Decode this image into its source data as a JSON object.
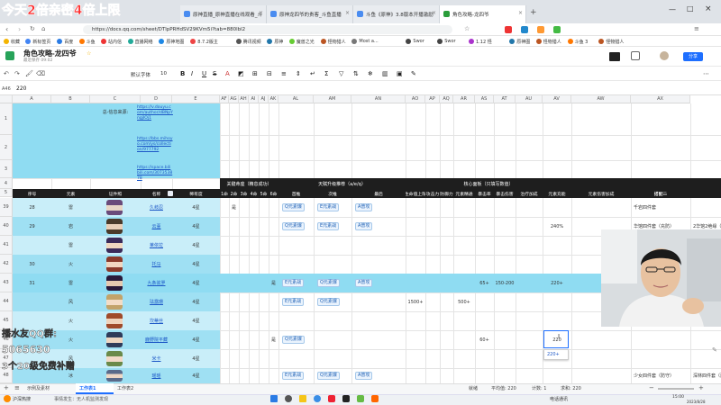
{
  "browser": {
    "tabs": [
      {
        "label": "原神直播_原神直播在线观看_斗",
        "active": false
      },
      {
        "label": "原神龙四爷的贵客_斗鱼直播",
        "active": false
      },
      {
        "label": "斗鱼《原神》3.8版本开播激励",
        "active": false
      },
      {
        "label": "角色攻略-龙四爷",
        "active": true
      }
    ],
    "url": "https://docs.qq.com/sheet/DTlpPRHdSV29KVm5i?tab=880lbl2",
    "bookmarks": [
      "收藏",
      "新标签页",
      "百度",
      "斗鱼",
      "站内信",
      "直播网络",
      "原神地图",
      "8.7.2版主",
      "腾讯视频",
      "原神",
      "魔兽之光",
      "怪物猎人",
      "Most a...",
      "Swor",
      "Swor",
      "1.12 怪",
      "原神图",
      "怪物猎人",
      "斗鱼 3",
      "怪物猎人"
    ]
  },
  "doc": {
    "title": "角色攻略-龙四爷",
    "subtitle": "最近保存 09:02",
    "share_label": "分享",
    "font_name": "默认字体",
    "font_size": "10",
    "cell_ref": "A46",
    "formula_value": "220"
  },
  "overlay": {
    "banner": "今天2倍亲密4倍上限",
    "fan_group_label": "播水友QQ群:",
    "fan_group_number": "5065630",
    "fan_group_extra": "3个20级免费补赠"
  },
  "columns": [
    "A",
    "B",
    "C",
    "D",
    "E",
    "AF",
    "AG",
    "AH",
    "AI",
    "AJ",
    "AK",
    "AL",
    "AM",
    "AN",
    "AO",
    "AP",
    "AQ",
    "AR",
    "AS",
    "AT",
    "AU",
    "AV",
    "AW",
    "AX"
  ],
  "rows": [
    "1",
    "2",
    "3",
    "4",
    "5",
    "39",
    "40",
    "41",
    "42",
    "43",
    "44",
    "45",
    "46",
    "47",
    "48"
  ],
  "info": {
    "label": "总-信息来源:",
    "link1": "https://v.douyu.com/author/dBNpYngjIOj1",
    "link2": "https://bbs.mihoyo.com/ys/collection/977792",
    "link3": "https://space.bilibili.com/307353878"
  },
  "section_headers": {
    "constellation": "关键命座（精息成功）",
    "talent": "天赋升级推荐（a/e/q）",
    "core_panel": "核心面板（只填写数值）"
  },
  "headers": {
    "serial": "序号",
    "element": "元素",
    "portrait": "证件照",
    "name": "名称",
    "rarity": "稀有度",
    "c1": "1命",
    "c2": "2命",
    "c3": "3命",
    "c4": "4命",
    "c5": "5命",
    "c6": "6命",
    "t_first": "首推",
    "t_second": "次推",
    "t_last": "最后",
    "hp": "生命值上限",
    "atk": "攻击力",
    "def": "防御力",
    "em": "元素精通",
    "crit_rate": "暴击率",
    "crit_dmg": "暴击伤害",
    "heal": "治疗加成",
    "er": "元素充能",
    "elem_dmg": "元素伤害加成",
    "set1": "搭配一",
    "set2": "搭配二"
  },
  "table_rows": [
    {
      "row": "39",
      "serial": "28",
      "element": "雷",
      "name": "久岐忍",
      "rarity": "4星",
      "c1": "",
      "c2": "是",
      "c6": "",
      "t_first": "Q元素爆",
      "t_second": "E元素战",
      "t_last": "A普攻",
      "hp": "",
      "atk": "",
      "def": "",
      "em": "",
      "cr": "",
      "cd": "",
      "heal": "",
      "er": "",
      "set1": "千岩四件套",
      "set2": "",
      "highlight": false
    },
    {
      "row": "40",
      "serial": "29",
      "element": "岩",
      "name": "云堇",
      "rarity": "4星",
      "c1": "",
      "c2": "",
      "c6": "",
      "t_first": "Q元素爆",
      "t_second": "E元素战",
      "t_last": "A普攻",
      "hp": "",
      "atk": "",
      "def": "",
      "em": "",
      "cr": "",
      "cd": "",
      "heal": "",
      "er": "240%",
      "set1": "华馆四件套（充防）",
      "set2": "2华馆2绝缘（防）",
      "highlight": false
    },
    {
      "row": "41",
      "serial": "",
      "element": "雷",
      "name": "莱依拉",
      "rarity": "4星",
      "c1": "",
      "c2": "",
      "c6": "",
      "t_first": "",
      "t_second": "",
      "t_last": "",
      "hp": "",
      "atk": "",
      "def": "",
      "em": "",
      "cr": "",
      "cd": "",
      "heal": "",
      "er": "",
      "set1": "",
      "set2": "",
      "highlight": false
    },
    {
      "row": "42",
      "serial": "30",
      "element": "火",
      "name": "托马",
      "rarity": "4星",
      "c1": "",
      "c2": "",
      "c6": "",
      "t_first": "",
      "t_second": "",
      "t_last": "",
      "hp": "",
      "atk": "",
      "def": "",
      "em": "",
      "cr": "",
      "cd": "",
      "heal": "",
      "er": "",
      "set1": "",
      "set2": "",
      "highlight": false
    },
    {
      "row": "43",
      "serial": "31",
      "element": "雷",
      "name": "九条裟罗",
      "rarity": "4星",
      "c1": "",
      "c2": "",
      "c6": "是",
      "t_first": "E元素战",
      "t_second": "Q元素爆",
      "t_last": "A普攻",
      "hp": "",
      "atk": "",
      "def": "",
      "em": "",
      "cr": "65+",
      "cd": "150-200",
      "heal": "",
      "er": "220+",
      "set1": "",
      "set2": "",
      "highlight": true
    },
    {
      "row": "44",
      "serial": "",
      "element": "风",
      "name": "珐露珊",
      "rarity": "4星",
      "c1": "",
      "c2": "",
      "c6": "",
      "t_first": "E元素战",
      "t_second": "Q元素爆",
      "t_last": "",
      "hp": "1500+",
      "atk": "",
      "def": "",
      "em": "500+",
      "cr": "",
      "cd": "",
      "heal": "",
      "er": "",
      "set1": "",
      "set2": "",
      "highlight": false
    },
    {
      "row": "45",
      "serial": "",
      "element": "火",
      "name": "坎蒂丝",
      "rarity": "4星",
      "c1": "",
      "c2": "",
      "c6": "",
      "t_first": "",
      "t_second": "",
      "t_last": "",
      "hp": "",
      "atk": "",
      "def": "",
      "em": "",
      "cr": "",
      "cd": "",
      "heal": "",
      "er": "",
      "set1": "",
      "set2": "",
      "highlight": false
    },
    {
      "row": "46",
      "serial": "",
      "element": "火",
      "name": "鹿野院平藏",
      "rarity": "4星",
      "c1": "",
      "c2": "",
      "c6": "是",
      "t_first": "Q元素爆",
      "t_second": "",
      "t_last": "",
      "hp": "",
      "atk": "",
      "def": "",
      "em": "",
      "cr": "60+",
      "cd": "",
      "heal": "",
      "er": "220",
      "set1": "",
      "set2": "",
      "highlight": false
    },
    {
      "row": "47",
      "serial": "",
      "element": "风",
      "name": "米卡",
      "rarity": "4星",
      "c1": "",
      "c2": "",
      "c6": "",
      "t_first": "",
      "t_second": "",
      "t_last": "",
      "hp": "",
      "atk": "",
      "def": "",
      "em": "",
      "cr": "",
      "cd": "",
      "heal": "",
      "er": "",
      "set1": "",
      "set2": "",
      "highlight": false
    },
    {
      "row": "48",
      "serial": "",
      "element": "冰",
      "name": "瑶瑶",
      "rarity": "4星",
      "c1": "",
      "c2": "",
      "c6": "",
      "t_first": "E元素战",
      "t_second": "Q元素爆",
      "t_last": "A普攻",
      "hp": "",
      "atk": "",
      "def": "",
      "em": "",
      "cr": "",
      "cd": "",
      "heal": "",
      "er": "",
      "set1": "少女四件套（防守）",
      "set2": "深林四件套（建议）",
      "highlight": false
    }
  ],
  "autocomplete": "220+",
  "sheets": [
    "示例及素材",
    "工作表1",
    "工作表2"
  ],
  "status_items": [
    "就绪",
    "平均值: 220",
    "计数: 1",
    "求和: 220"
  ],
  "taskbar": {
    "left": "沪深热搜",
    "search": "事情发生：无人机监测发现",
    "time": "15:00",
    "date": "2023/8/28",
    "right_label": "电话通讯"
  }
}
